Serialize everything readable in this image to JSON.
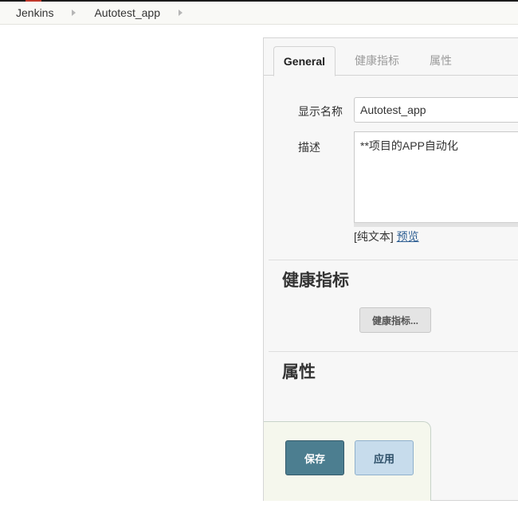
{
  "breadcrumb": {
    "items": [
      "Jenkins",
      "Autotest_app"
    ]
  },
  "tabs": [
    "General",
    "健康指标",
    "属性"
  ],
  "general": {
    "display_name_label": "显示名称",
    "display_name_value": "Autotest_app",
    "description_label": "描述",
    "description_value": "**项目的APP自动化",
    "format_plain": "[纯文本]",
    "format_preview": "预览"
  },
  "health": {
    "title": "健康指标",
    "button_label": "健康指标..."
  },
  "properties": {
    "title": "属性"
  },
  "actions": {
    "save_label": "保存",
    "apply_label": "应用"
  }
}
